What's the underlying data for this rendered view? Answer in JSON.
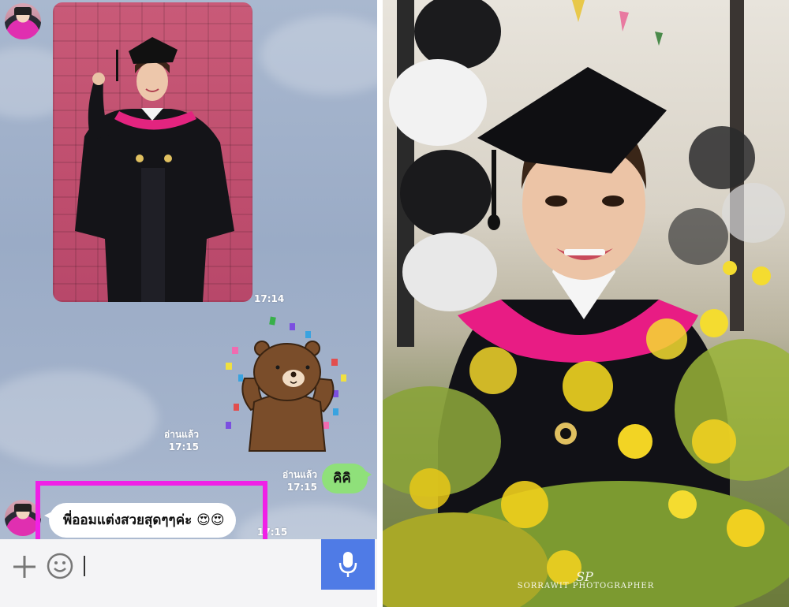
{
  "chat": {
    "photo_time": "17:14",
    "sticker_read": "อ่านแล้ว",
    "sticker_time": "17:15",
    "reply_read": "อ่านแล้ว",
    "reply_time": "17:15",
    "reply_text": "คิคิ",
    "incoming_text": "พี่ออมแต่งสวยสุดๆๆค่ะ 😍😍",
    "incoming_time": "17:15",
    "colors": {
      "chat_bg": "#9aabc6",
      "sent_bubble": "#8fe07a",
      "received_bubble": "#ffffff",
      "highlight": "#f020e6",
      "mic_button": "#4f7be6"
    },
    "icons": [
      "plus-icon",
      "emoji-icon",
      "microphone-icon"
    ]
  },
  "portrait": {
    "watermark": "SORRAWIT PHOTOGRAPHER",
    "watermark_logo": "SP"
  }
}
